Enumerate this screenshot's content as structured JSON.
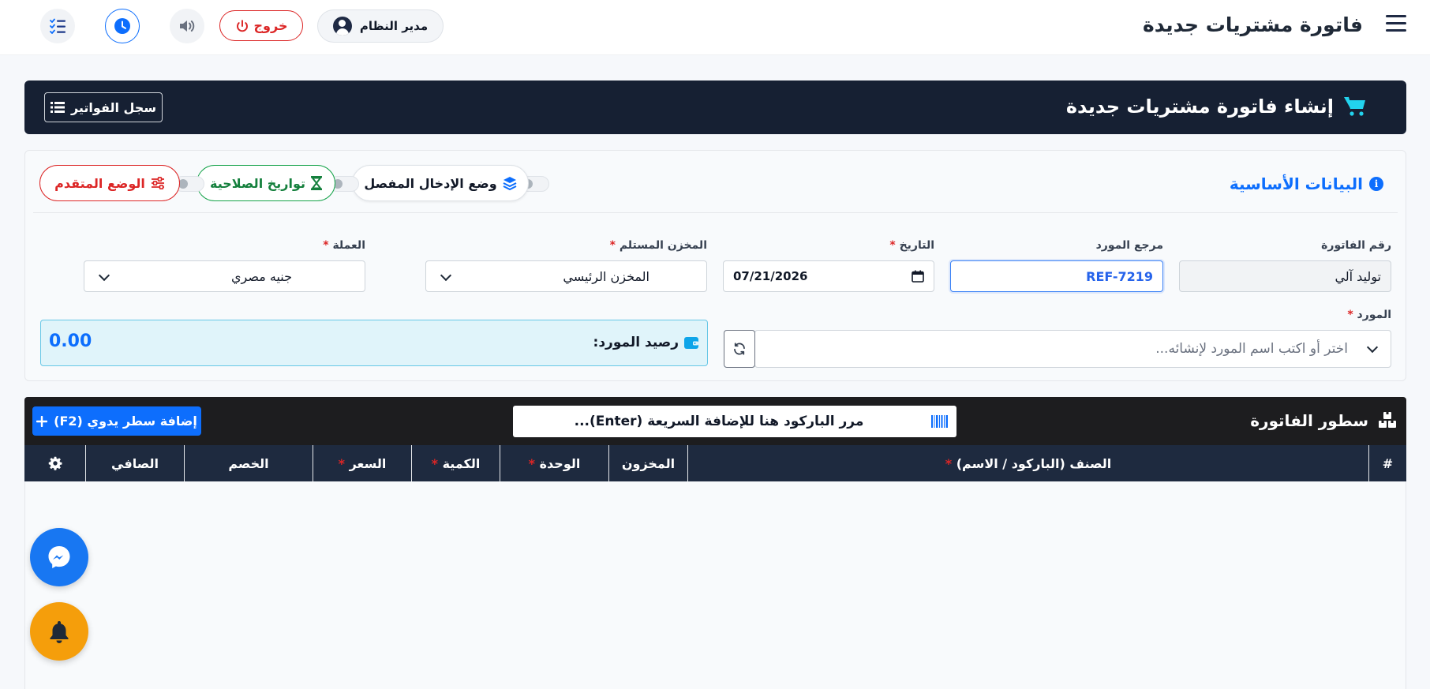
{
  "header": {
    "title": "فاتورة مشتريات جديدة",
    "user_name": "مدير النظام",
    "logout_label": "خروج"
  },
  "banner": {
    "title": "إنشاء فاتورة مشتريات جديدة",
    "invoices_log_label": "سجل الفواتير"
  },
  "basic_data": {
    "section_title": "البيانات الأساسية",
    "modes": {
      "detailed_entry": "وضع الإدخال المفصل",
      "expiry_dates": "تواريخ الصلاحية",
      "advanced_mode": "الوضع المتقدم"
    },
    "fields": {
      "invoice_number": {
        "label": "رقم الفاتورة",
        "value": "توليد آلي"
      },
      "supplier_ref": {
        "label": "مرجع المورد",
        "value": "REF-7219"
      },
      "date": {
        "label": "التاريخ",
        "value": "07/21/2026",
        "required": "*"
      },
      "warehouse": {
        "label": "المخزن المستلم",
        "value": "المخزن الرئيسي",
        "required": "*"
      },
      "currency": {
        "label": "العملة",
        "value": "جنيه مصري",
        "required": "*"
      },
      "supplier": {
        "label": "المورد",
        "placeholder": "اختر أو اكتب اسم المورد لإنشائه...",
        "required": "*"
      }
    },
    "supplier_balance": {
      "label": "رصيد المورد:",
      "value": "0.00"
    }
  },
  "invoice_lines": {
    "title": "سطور الفاتورة",
    "barcode_placeholder": "مرر الباركود هنا للإضافة السريعة (Enter)...",
    "add_line_label": "إضافة سطر يدوي (F2)",
    "columns": {
      "index": "#",
      "item": "الصنف (الباركود / الاسم)",
      "stock": "المخزون",
      "unit": "الوحدة",
      "quantity": "الكمية",
      "price": "السعر",
      "discount": "الخصم",
      "net": "الصافي"
    },
    "required_mark": "*"
  },
  "colors": {
    "primary": "#0d6efd",
    "danger": "#dc2626",
    "success": "#16a34a",
    "dark": "#162033",
    "warning": "#f59e0b"
  }
}
